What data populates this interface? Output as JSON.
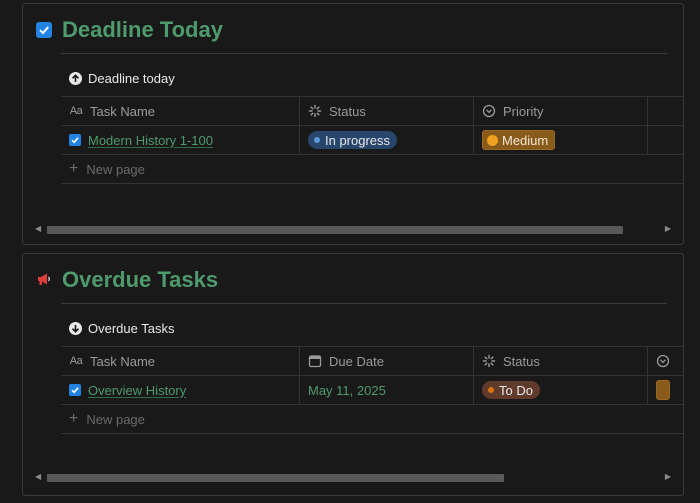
{
  "sections": [
    {
      "title": "Deadline Today",
      "view_title": "Deadline today",
      "columns": [
        "Task Name",
        "Status",
        "Priority"
      ],
      "rows": [
        {
          "task": "Modern History 1-100",
          "status": "In progress",
          "priority": "Medium"
        }
      ],
      "new_page_label": "New page"
    },
    {
      "title": "Overdue Tasks",
      "view_title": "Overdue Tasks",
      "columns": [
        "Task Name",
        "Due Date",
        "Status"
      ],
      "rows": [
        {
          "task": "Overview History",
          "due_date": "May 11, 2025",
          "status": "To Do"
        }
      ],
      "new_page_label": "New page"
    }
  ],
  "icons": {
    "section1_header": "checkbox-icon",
    "section2_header": "megaphone-icon",
    "section1_view": "arrow-up-circle-icon",
    "section2_view": "arrow-down-circle-icon"
  },
  "colors": {
    "title_green": "#4f9a6c",
    "status_blue": "#28456c",
    "status_brown": "#603b2c",
    "priority_orange": "#895b1a",
    "checkbox_blue": "#2383e2"
  }
}
